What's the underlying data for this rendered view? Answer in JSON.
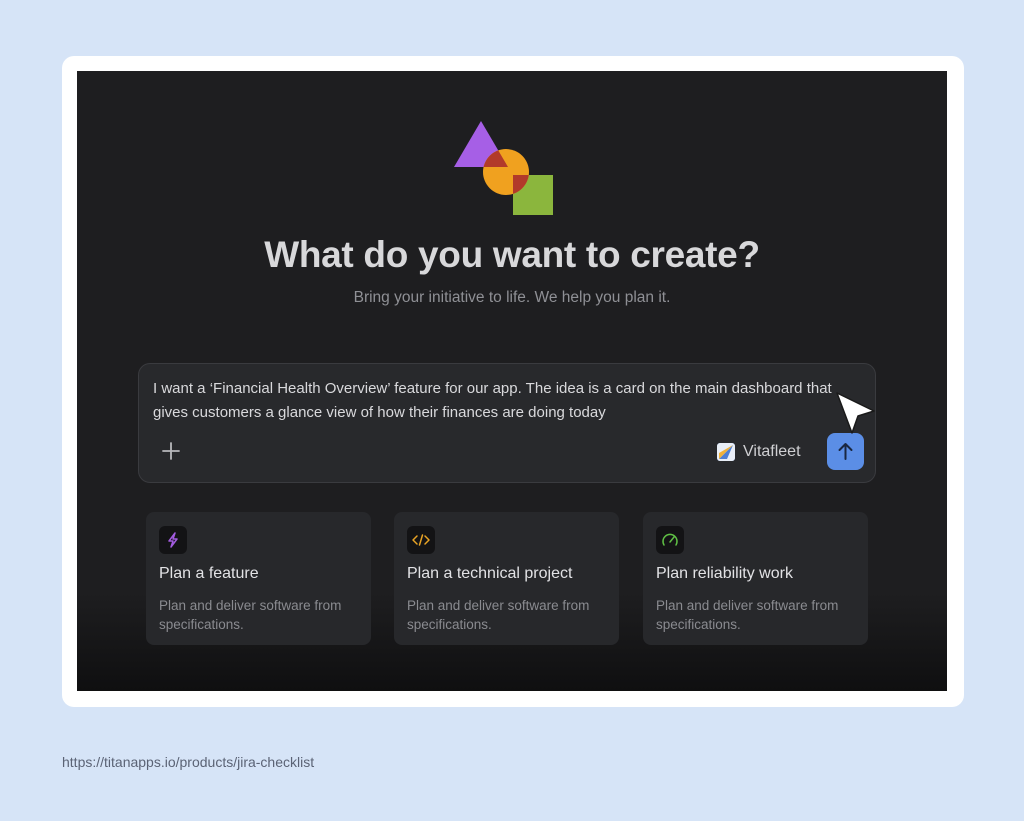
{
  "hero": {
    "title": "What do you want to create?",
    "subtitle": "Bring your initiative to life. We help you plan it."
  },
  "composer": {
    "text": "I want a ‘Financial Health Overview’ feature for our app. The idea is a card on the main dashboard that gives customers a glance view of how their finances are doing today",
    "add_icon": "plus-icon",
    "project_name": "Vitafleet",
    "send_icon": "arrow-up-icon"
  },
  "cards": [
    {
      "title": "Plan a feature",
      "description": "Plan and deliver software from specifications.",
      "icon": "lightning-icon",
      "icon_color": "#a35ce0"
    },
    {
      "title": "Plan a technical project",
      "description": "Plan and deliver software from specifications.",
      "icon": "code-icon",
      "icon_color": "#e8a325"
    },
    {
      "title": "Plan reliability work",
      "description": "Plan and deliver software from specifications.",
      "icon": "gauge-icon",
      "icon_color": "#5fbf45"
    }
  ],
  "footer": {
    "url": "https://titanapps.io/products/jira-checklist"
  },
  "colors": {
    "page_background": "#d6e4f7",
    "app_background": "#1e1e20",
    "accent": "#5b8ee6"
  }
}
